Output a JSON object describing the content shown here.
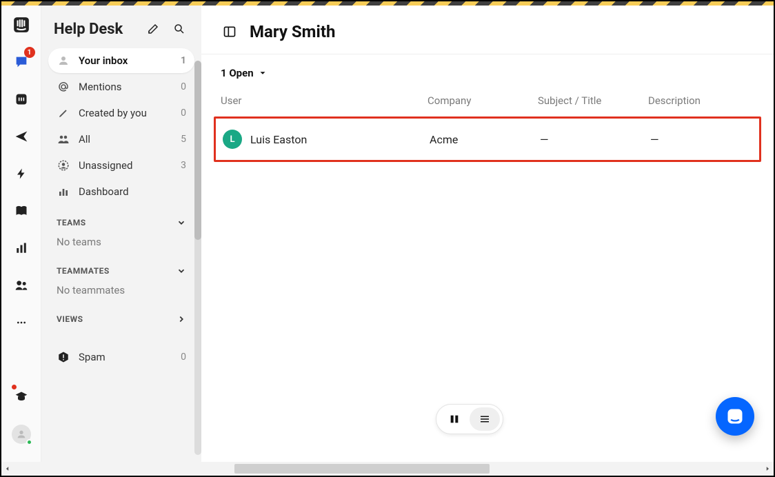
{
  "rail": {
    "inbox_badge": "1"
  },
  "sidebar": {
    "title": "Help Desk",
    "items": [
      {
        "label": "Your inbox",
        "count": "1"
      },
      {
        "label": "Mentions",
        "count": "0"
      },
      {
        "label": "Created by you",
        "count": "0"
      },
      {
        "label": "All",
        "count": "5"
      },
      {
        "label": "Unassigned",
        "count": "3"
      },
      {
        "label": "Dashboard",
        "count": ""
      }
    ],
    "teams_header": "TEAMS",
    "teams_empty": "No teams",
    "teammates_header": "TEAMMATES",
    "teammates_empty": "No teammates",
    "views_header": "VIEWS",
    "spam": {
      "label": "Spam",
      "count": "0"
    }
  },
  "main": {
    "title": "Mary Smith",
    "filter_label": "1 Open",
    "columns": {
      "user": "User",
      "company": "Company",
      "subject": "Subject / Title",
      "description": "Description"
    },
    "rows": [
      {
        "avatar_initial": "L",
        "user": "Luis Easton",
        "company": "Acme",
        "subject": "—",
        "description": "—"
      }
    ]
  }
}
